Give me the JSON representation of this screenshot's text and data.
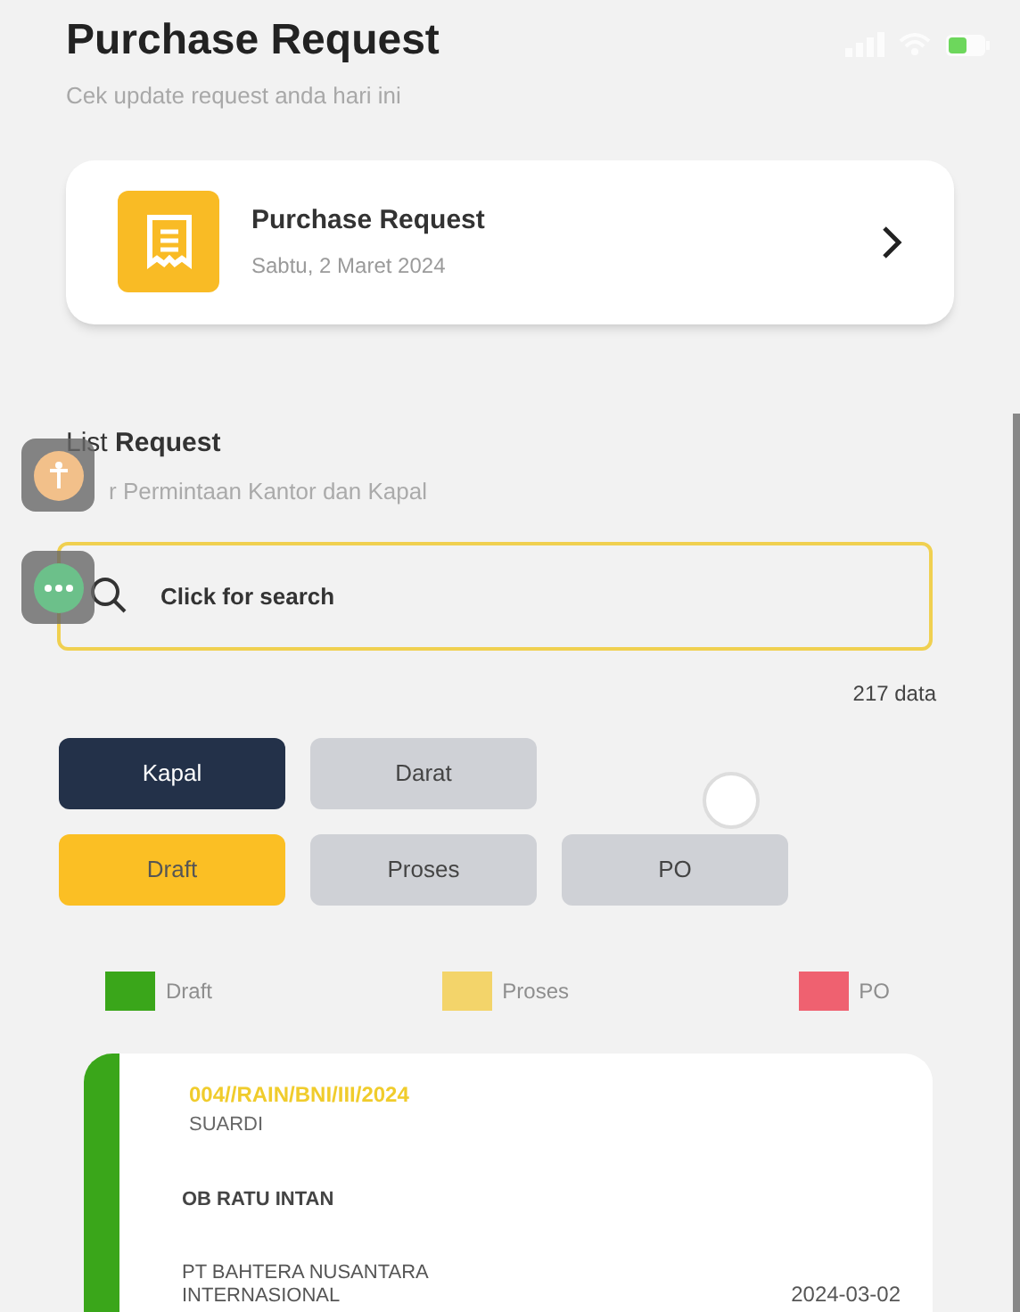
{
  "header": {
    "title": "Purchase Request",
    "subtitle": "Cek update request anda hari ini"
  },
  "menu_card": {
    "title": "Purchase Request",
    "date": "Sabtu, 2 Maret 2024"
  },
  "list": {
    "title_prefix": "List",
    "title": "Request",
    "subtitle": "r Permintaan Kantor dan Kapal"
  },
  "search": {
    "placeholder": "Click for search"
  },
  "count": "217 data",
  "type_filters": [
    {
      "label": "Kapal",
      "selected": true
    },
    {
      "label": "Darat",
      "selected": false
    }
  ],
  "status_filters": [
    {
      "label": "Draft",
      "selected": true
    },
    {
      "label": "Proses",
      "selected": false
    },
    {
      "label": "PO",
      "selected": false
    }
  ],
  "legend": [
    {
      "label": "Draft",
      "color": "#3aa61a"
    },
    {
      "label": "Proses",
      "color": "#f3d46a"
    },
    {
      "label": "PO",
      "color": "#ef6170"
    }
  ],
  "requests": [
    {
      "number": "004//RAIN/BNI/III/2024",
      "requester": "SUARDI",
      "vessel": "OB RATU INTAN",
      "company": "PT BAHTERA NUSANTARA INTERNASIONAL",
      "date": "2024-03-02",
      "color": "#3aa61a"
    }
  ]
}
